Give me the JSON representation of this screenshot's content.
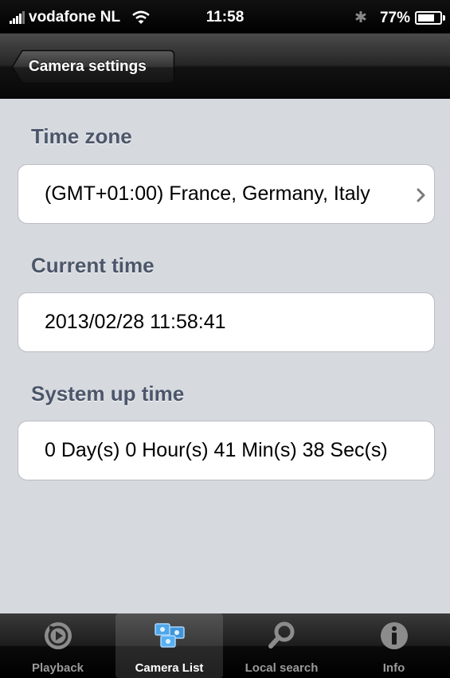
{
  "status_bar": {
    "carrier": "vodafone NL",
    "time": "11:58",
    "battery": "77%",
    "battery_level": 0.77
  },
  "nav_bar": {
    "back_label": "Camera settings"
  },
  "sections": {
    "time_zone": {
      "title": "Time zone",
      "value": "(GMT+01:00) France, Germany, Italy"
    },
    "current_time": {
      "title": "Current time",
      "value": "2013/02/28 11:58:41"
    },
    "system_up_time": {
      "title": "System up time",
      "value": "0 Day(s) 0 Hour(s) 41 Min(s) 38 Sec(s)"
    }
  },
  "tab_bar": {
    "selected": "camera_list",
    "tabs": [
      {
        "label": "Playback",
        "icon": "playback-icon"
      },
      {
        "label": "Camera List",
        "icon": "camera-list-icon"
      },
      {
        "label": "Local search",
        "icon": "search-icon"
      },
      {
        "label": "Info",
        "icon": "info-icon"
      }
    ]
  },
  "colors": {
    "background": "#d6d9de",
    "section_title": "#4c566a",
    "bar": "#000000"
  }
}
